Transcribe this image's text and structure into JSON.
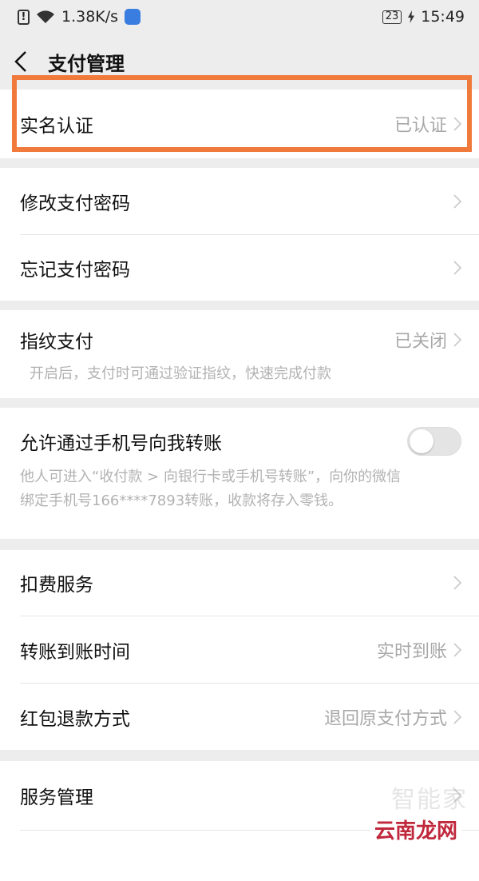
{
  "status_bar": {
    "speed": "1.38K/s",
    "battery": "23",
    "time": "15:49"
  },
  "header": {
    "title": "支付管理"
  },
  "real_name": {
    "label": "实名认证",
    "value": "已认证"
  },
  "password": {
    "change_label": "修改支付密码",
    "forgot_label": "忘记支付密码"
  },
  "fingerprint": {
    "label": "指纹支付",
    "value": "已关闭",
    "hint": "开启后，支付时可通过验证指纹，快速完成付款"
  },
  "phone_transfer": {
    "label": "允许通过手机号向我转账",
    "toggle_on": false,
    "hint_line1": "他人可进入“收付款 > 向银行卡或手机号转账”，向你的微信",
    "hint_line2": "绑定手机号166****7893转账，收款将存入零钱。"
  },
  "services": {
    "deduct_label": "扣费服务",
    "arrival_label": "转账到账时间",
    "arrival_value": "实时到账",
    "refund_label": "红包退款方式",
    "refund_value": "退回原支付方式"
  },
  "service_manage": {
    "label": "服务管理"
  },
  "watermark": {
    "top": "智能家",
    "bottom": "云南龙网"
  },
  "colors": {
    "highlight": "#f07a3c",
    "background": "#ededed",
    "secondary_text": "#a8a8a8"
  }
}
